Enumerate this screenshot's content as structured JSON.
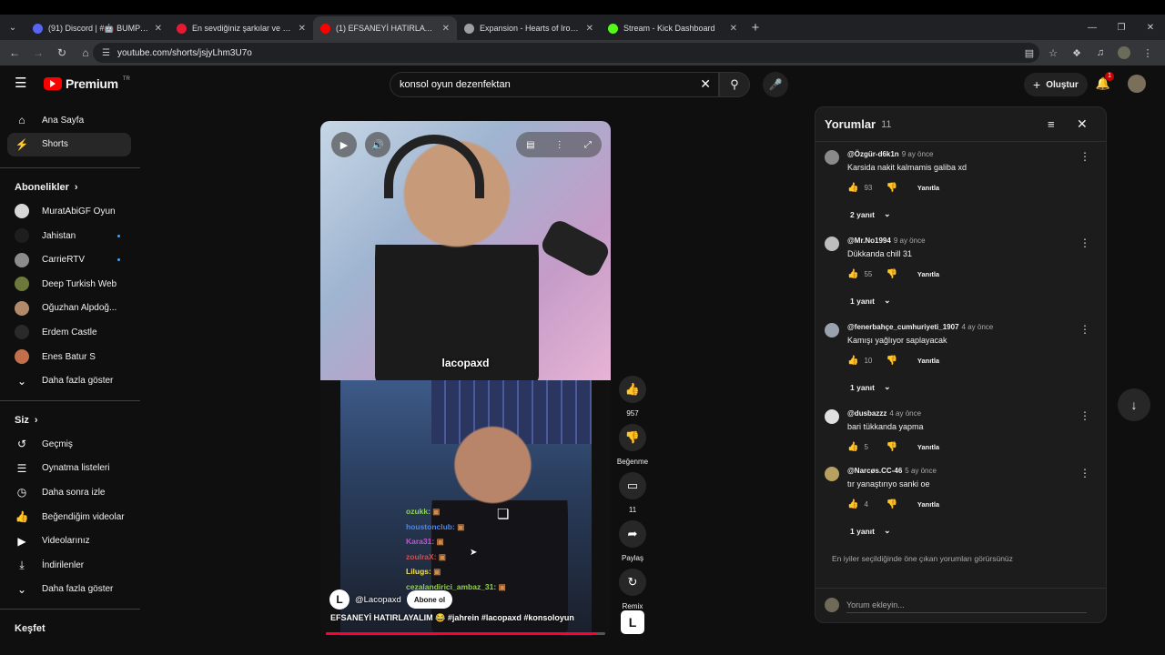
{
  "browser": {
    "tabs": [
      {
        "title": "(91) Discord | #🤖 BUMP | Nnum",
        "color": "#5865f2",
        "active": false
      },
      {
        "title": "En sevdiğiniz şarkılar ve albüml",
        "color": "#e51937",
        "active": false
      },
      {
        "title": "(1) EFSANEYİ HATIRLAYALIM 😂",
        "color": "#ff0000",
        "active": true
      },
      {
        "title": "Expansion - Hearts of Iron IV: N",
        "color": "#9aa0a6",
        "active": false
      },
      {
        "title": "Stream - Kick Dashboard",
        "color": "#53fc18",
        "active": false
      }
    ],
    "url": "youtube.com/shorts/jsjyLhm3U7o"
  },
  "header": {
    "brand": "Premium",
    "region": "TR",
    "search_value": "konsol oyun dezenfektan",
    "create_label": "Oluştur",
    "notif_count": "1"
  },
  "sidebar": {
    "main": [
      {
        "label": "Ana Sayfa",
        "icon": "home-icon",
        "glyph": "⌂"
      },
      {
        "label": "Shorts",
        "icon": "shorts-icon",
        "glyph": "⚡"
      }
    ],
    "subs_title": "Abonelikler",
    "subs": [
      {
        "label": "MuratAbiGF Oyun",
        "color": "#d8d8d8",
        "dot": true
      },
      {
        "label": "Jahistan",
        "color": "#1e1e1e",
        "dot": true
      },
      {
        "label": "CarrieRTV",
        "color": "#8c8c8c",
        "dot": true
      },
      {
        "label": "Deep Turkish Web",
        "color": "#6b7a3a",
        "dot": true
      },
      {
        "label": "Oğuzhan Alpdoğ...",
        "color": "#b08a6a",
        "dot": true
      },
      {
        "label": "Erdem Castle",
        "color": "#2a2a2a",
        "dot": false
      },
      {
        "label": "Enes Batur S",
        "color": "#c0704a",
        "dot": false
      }
    ],
    "subs_more": "Daha fazla göster",
    "you_title": "Siz",
    "you": [
      {
        "label": "Geçmiş",
        "icon": "history-icon",
        "glyph": "↺"
      },
      {
        "label": "Oynatma listeleri",
        "icon": "playlists-icon",
        "glyph": "☰"
      },
      {
        "label": "Daha sonra izle",
        "icon": "watch-later-icon",
        "glyph": "◷"
      },
      {
        "label": "Beğendiğim videolar",
        "icon": "liked-icon",
        "glyph": "👍"
      },
      {
        "label": "Videolarınız",
        "icon": "your-videos-icon",
        "glyph": "▶"
      },
      {
        "label": "İndirilenler",
        "icon": "downloads-icon",
        "glyph": "⤓"
      },
      {
        "label": "Daha fazla göster",
        "icon": "chevron-down-icon",
        "glyph": "⌄"
      }
    ],
    "explore_title": "Keşfet"
  },
  "short": {
    "overlay_name": "lacopaxd",
    "chat": [
      {
        "name": "ozukk:",
        "color": "#8fd14f"
      },
      {
        "name": "houstonclub:",
        "color": "#4a86e8"
      },
      {
        "name": "Kara31:",
        "color": "#c94fd1"
      },
      {
        "name": "zoulraX:",
        "color": "#d14f4f"
      },
      {
        "name": "Lilugs:",
        "color": "#f1e04f"
      },
      {
        "name": "cezalandirici_ambaz_31:",
        "color": "#8fd14f"
      }
    ],
    "channel": "@Lacopaxd",
    "subscribe_label": "Abone ol",
    "caption": "EFSANEYİ HATIRLAYALIM 😂 #jahrein #lacopaxd #konsoloyun",
    "progress": 0.97,
    "actions": [
      {
        "label": "957",
        "icon": "like-icon",
        "glyph": "👍"
      },
      {
        "label": "Beğenme",
        "icon": "dislike-icon",
        "glyph": "👎"
      },
      {
        "label": "11",
        "icon": "comments-icon",
        "glyph": "▭"
      },
      {
        "label": "Paylaş",
        "icon": "share-icon",
        "glyph": "➦"
      },
      {
        "label": "Remix",
        "icon": "remix-icon",
        "glyph": "↻"
      }
    ]
  },
  "comments": {
    "title": "Yorumlar",
    "count": "11",
    "items": [
      {
        "user": "@Özgür-d6k1n",
        "time": "9 ay önce",
        "text": "Karsida nakit kalmamis galiba xd",
        "likes": "93",
        "replies": "2 yanıt",
        "avatar": "#8a8a8a"
      },
      {
        "user": "@Mr.No1994",
        "time": "9 ay önce",
        "text": "Dükkanda chill 31",
        "likes": "55",
        "replies": "1 yanıt",
        "avatar": "#bdbdbd"
      },
      {
        "user": "@fenerbahçe_cumhuriyeti_1907",
        "time": "4 ay önce",
        "text": "Kamışı yağlıyor saplayacak",
        "likes": "10",
        "replies": "1 yanıt",
        "avatar": "#9aa3ad"
      },
      {
        "user": "@dusbazzz",
        "time": "4 ay önce",
        "text": "bari tükkanda yapma",
        "likes": "5",
        "replies": "",
        "avatar": "#e0e0e0"
      },
      {
        "user": "@Narcøs.CC-46",
        "time": "5 ay önce",
        "text": "tır yanaştırıyo sanki oe",
        "likes": "4",
        "replies": "1 yanıt",
        "avatar": "#b8a060"
      }
    ],
    "reply_label": "Yanıtla",
    "note": "En iyiler seçildiğinde öne çıkan yorumları görürsünüz",
    "input_placeholder": "Yorum ekleyin..."
  }
}
